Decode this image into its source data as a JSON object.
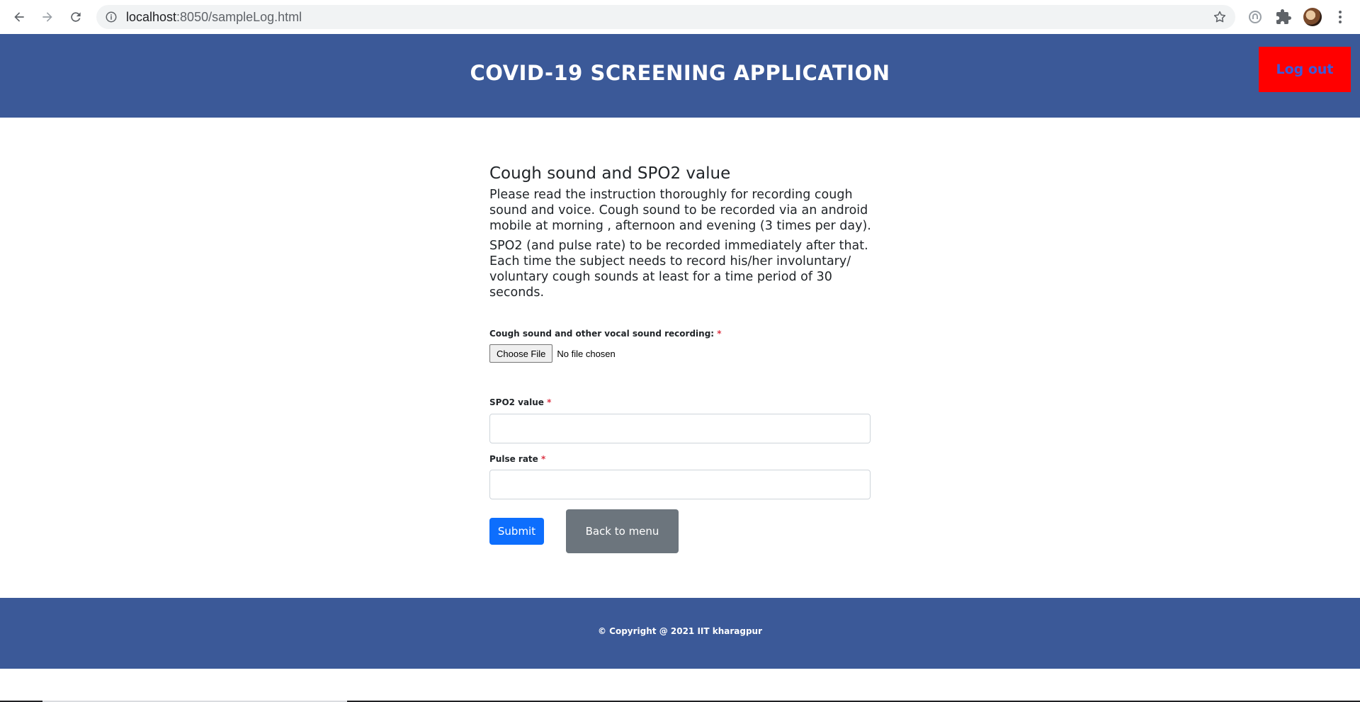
{
  "browser": {
    "url_host": "localhost",
    "url_path": ":8050/sampleLog.html",
    "icons": [
      "back-arrow-icon",
      "forward-arrow-icon",
      "reload-icon",
      "info-icon",
      "star-icon",
      "extension-icon",
      "puzzle-icon",
      "profile-avatar",
      "more-vert-icon"
    ]
  },
  "header": {
    "title": "COVID-19 SCREENING APPLICATION",
    "logout_label": "Log out"
  },
  "main": {
    "section_title": "Cough sound and SPO2 value",
    "instruction_1": "Please read the instruction thoroughly for recording cough sound and voice. Cough sound to be recorded via an android mobile at morning , afternoon and evening (3 times per day).",
    "instruction_2": "SPO2 (and pulse rate) to be recorded immediately after that. Each time the subject needs to record his/her involuntary/ voluntary cough sounds at least for a time period of 30 seconds.",
    "file_label": "Cough sound and other vocal sound recording:",
    "required_mark": "*",
    "choose_file_label": "Choose File",
    "no_file_text": "No file chosen",
    "spo2_label": "SPO2 value",
    "spo2_value": "",
    "pulse_label": "Pulse rate",
    "pulse_value": "",
    "submit_label": "Submit",
    "back_label": "Back to menu"
  },
  "footer": {
    "text": "© Copyright @ 2021  IIT kharagpur"
  },
  "colors": {
    "header_bg": "#3b5998",
    "logout_bg": "#ff0000",
    "logout_text": "#3b5bdb",
    "submit_bg": "#0d6efd",
    "back_bg": "#6c757d",
    "required": "#dc3545"
  }
}
